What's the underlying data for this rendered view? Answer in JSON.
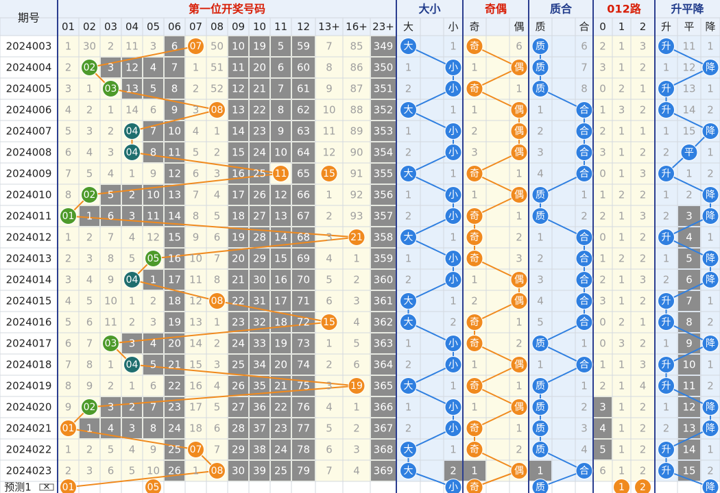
{
  "header": {
    "period_label": "期号",
    "groups": [
      {
        "title": "第一位开奖号码",
        "color": "#d81e06"
      },
      {
        "title": "大小",
        "color": "#1f3a8a"
      },
      {
        "title": "奇偶",
        "color": "#d81e06"
      },
      {
        "title": "质合",
        "color": "#1f3a8a"
      },
      {
        "title": "012路",
        "color": "#d81e06"
      },
      {
        "title": "升平降",
        "color": "#1f3a8a"
      }
    ],
    "subheaders": [
      "01",
      "02",
      "03",
      "04",
      "05",
      "06",
      "07",
      "08",
      "09",
      "10",
      "11",
      "12",
      "13+",
      "16+",
      "23+",
      "大",
      "",
      "小",
      "奇",
      "",
      "偶",
      "质",
      "",
      "合",
      "0",
      "1",
      "2",
      "升",
      "平",
      "降"
    ]
  },
  "chart_data": {
    "type": "table",
    "title": "第一位开奖号码",
    "rows": [
      {
        "period": "2024003",
        "cells": [
          "1",
          "30",
          "2",
          "11",
          "3",
          "6",
          "07",
          "50",
          "10",
          "19",
          "5",
          "59",
          "7",
          "85",
          "349",
          "大",
          "",
          "1",
          "奇",
          "",
          "6",
          "质",
          "",
          "6",
          "2",
          "1",
          "3",
          "升",
          "11",
          "1"
        ]
      },
      {
        "period": "2024004",
        "cells": [
          "2",
          "02",
          "3",
          "12",
          "4",
          "7",
          "1",
          "51",
          "11",
          "20",
          "6",
          "60",
          "8",
          "86",
          "350",
          "1",
          "",
          "小",
          "1",
          "",
          "偶",
          "质",
          "",
          "7",
          "3",
          "1",
          "2",
          "1",
          "12",
          "降"
        ]
      },
      {
        "period": "2024005",
        "cells": [
          "3",
          "1",
          "03",
          "13",
          "5",
          "8",
          "2",
          "52",
          "12",
          "21",
          "7",
          "61",
          "9",
          "87",
          "351",
          "2",
          "",
          "小",
          "奇",
          "",
          "1",
          "质",
          "",
          "8",
          "0",
          "2",
          "1",
          "升",
          "13",
          "1"
        ]
      },
      {
        "period": "2024006",
        "cells": [
          "4",
          "2",
          "1",
          "14",
          "6",
          "9",
          "3",
          "08",
          "13",
          "22",
          "8",
          "62",
          "10",
          "88",
          "352",
          "大",
          "",
          "1",
          "1",
          "",
          "偶",
          "1",
          "",
          "合",
          "1",
          "3",
          "2",
          "升",
          "14",
          "2"
        ]
      },
      {
        "period": "2024007",
        "cells": [
          "5",
          "3",
          "2",
          "04",
          "7",
          "10",
          "4",
          "1",
          "14",
          "23",
          "9",
          "63",
          "11",
          "89",
          "353",
          "1",
          "",
          "小",
          "2",
          "",
          "偶",
          "2",
          "",
          "合",
          "2",
          "1",
          "1",
          "1",
          "15",
          "降"
        ]
      },
      {
        "period": "2024008",
        "cells": [
          "6",
          "4",
          "3",
          "04",
          "8",
          "11",
          "5",
          "2",
          "15",
          "24",
          "10",
          "64",
          "12",
          "90",
          "354",
          "2",
          "",
          "小",
          "3",
          "",
          "偶",
          "3",
          "",
          "合",
          "3",
          "1",
          "2",
          "2",
          "平",
          "1"
        ]
      },
      {
        "period": "2024009",
        "cells": [
          "7",
          "5",
          "4",
          "1",
          "9",
          "12",
          "6",
          "3",
          "16",
          "25",
          "11",
          "65",
          "15",
          "91",
          "355",
          "大",
          "",
          "1",
          "奇",
          "",
          "1",
          "4",
          "",
          "合",
          "0",
          "1",
          "3",
          "升",
          "1",
          "2"
        ]
      },
      {
        "period": "2024010",
        "cells": [
          "8",
          "02",
          "5",
          "2",
          "10",
          "13",
          "7",
          "4",
          "17",
          "26",
          "12",
          "66",
          "1",
          "92",
          "356",
          "1",
          "",
          "小",
          "1",
          "",
          "偶",
          "质",
          "",
          "1",
          "1",
          "2",
          "2",
          "1",
          "2",
          "降"
        ]
      },
      {
        "period": "2024011",
        "cells": [
          "01",
          "1",
          "6",
          "3",
          "11",
          "14",
          "8",
          "5",
          "18",
          "27",
          "13",
          "67",
          "2",
          "93",
          "357",
          "2",
          "",
          "小",
          "奇",
          "",
          "1",
          "质",
          "",
          "2",
          "2",
          "1",
          "3",
          "2",
          "3",
          "降"
        ]
      },
      {
        "period": "2024012",
        "cells": [
          "1",
          "2",
          "7",
          "4",
          "12",
          "15",
          "9",
          "6",
          "19",
          "28",
          "14",
          "68",
          "3",
          "21",
          "358",
          "大",
          "",
          "1",
          "奇",
          "",
          "2",
          "1",
          "",
          "合",
          "0",
          "1",
          "2",
          "升",
          "4",
          "1"
        ]
      },
      {
        "period": "2024013",
        "cells": [
          "2",
          "3",
          "8",
          "5",
          "05",
          "16",
          "10",
          "7",
          "20",
          "29",
          "15",
          "69",
          "4",
          "1",
          "359",
          "1",
          "",
          "小",
          "奇",
          "",
          "3",
          "2",
          "",
          "合",
          "1",
          "2",
          "2",
          "1",
          "5",
          "降"
        ]
      },
      {
        "period": "2024014",
        "cells": [
          "3",
          "4",
          "9",
          "04",
          "1",
          "17",
          "11",
          "8",
          "21",
          "30",
          "16",
          "70",
          "5",
          "2",
          "360",
          "2",
          "",
          "小",
          "1",
          "",
          "偶",
          "3",
          "",
          "合",
          "2",
          "1",
          "3",
          "2",
          "6",
          "降"
        ]
      },
      {
        "period": "2024015",
        "cells": [
          "4",
          "5",
          "10",
          "1",
          "2",
          "18",
          "12",
          "08",
          "22",
          "31",
          "17",
          "71",
          "6",
          "3",
          "361",
          "大",
          "",
          "1",
          "2",
          "",
          "偶",
          "4",
          "",
          "合",
          "3",
          "1",
          "2",
          "升",
          "7",
          "1"
        ]
      },
      {
        "period": "2024016",
        "cells": [
          "5",
          "6",
          "11",
          "2",
          "3",
          "19",
          "13",
          "1",
          "23",
          "32",
          "18",
          "72",
          "15",
          "4",
          "362",
          "大",
          "",
          "2",
          "奇",
          "",
          "1",
          "5",
          "",
          "合",
          "0",
          "2",
          "1",
          "升",
          "8",
          "2"
        ]
      },
      {
        "period": "2024017",
        "cells": [
          "6",
          "7",
          "03",
          "3",
          "4",
          "20",
          "14",
          "2",
          "24",
          "33",
          "19",
          "73",
          "1",
          "5",
          "363",
          "1",
          "",
          "小",
          "奇",
          "",
          "2",
          "质",
          "",
          "1",
          "0",
          "3",
          "2",
          "1",
          "9",
          "降"
        ]
      },
      {
        "period": "2024018",
        "cells": [
          "7",
          "8",
          "1",
          "04",
          "5",
          "21",
          "15",
          "3",
          "25",
          "34",
          "20",
          "74",
          "2",
          "6",
          "364",
          "2",
          "",
          "小",
          "1",
          "",
          "偶",
          "1",
          "",
          "合",
          "1",
          "1",
          "3",
          "升",
          "10",
          "1"
        ]
      },
      {
        "period": "2024019",
        "cells": [
          "8",
          "9",
          "2",
          "1",
          "6",
          "22",
          "16",
          "4",
          "26",
          "35",
          "21",
          "75",
          "3",
          "19",
          "365",
          "大",
          "",
          "1",
          "奇",
          "",
          "1",
          "质",
          "",
          "1",
          "2",
          "1",
          "4",
          "升",
          "11",
          "2"
        ]
      },
      {
        "period": "2024020",
        "cells": [
          "9",
          "02",
          "3",
          "2",
          "7",
          "23",
          "17",
          "5",
          "27",
          "36",
          "22",
          "76",
          "4",
          "1",
          "366",
          "1",
          "",
          "小",
          "1",
          "",
          "偶",
          "质",
          "",
          "2",
          "3",
          "1",
          "2",
          "1",
          "12",
          "降"
        ]
      },
      {
        "period": "2024021",
        "cells": [
          "01",
          "1",
          "4",
          "3",
          "8",
          "24",
          "18",
          "6",
          "28",
          "37",
          "23",
          "77",
          "5",
          "2",
          "367",
          "2",
          "",
          "小",
          "奇",
          "",
          "1",
          "质",
          "",
          "3",
          "4",
          "1",
          "2",
          "2",
          "13",
          "降"
        ]
      },
      {
        "period": "2024022",
        "cells": [
          "1",
          "2",
          "5",
          "4",
          "9",
          "25",
          "07",
          "7",
          "29",
          "38",
          "24",
          "78",
          "6",
          "3",
          "368",
          "大",
          "",
          "1",
          "奇",
          "",
          "2",
          "质",
          "",
          "4",
          "5",
          "1",
          "2",
          "升",
          "14",
          "1"
        ]
      },
      {
        "period": "2024023",
        "cells": [
          "2",
          "3",
          "6",
          "5",
          "10",
          "26",
          "1",
          "08",
          "30",
          "39",
          "25",
          "79",
          "7",
          "4",
          "369",
          "大",
          "",
          "2",
          "1",
          "",
          "偶",
          "1",
          "",
          "合",
          "6",
          "1",
          "2",
          "升",
          "15",
          "2"
        ]
      },
      {
        "period": "预测1",
        "cells": [
          "01",
          "",
          "",
          "",
          "05",
          "",
          "",
          "",
          "",
          "",
          "",
          "",
          "",
          "",
          "",
          "",
          "",
          "小",
          "奇",
          "",
          "",
          "质",
          "",
          "",
          "",
          "1",
          "2",
          "",
          "",
          "降"
        ]
      }
    ],
    "x_marker": "✕"
  },
  "colors": {
    "header_bg": "#eaf1fa",
    "cream": "#fdfbe6",
    "blue_light": "#e6f0fb",
    "gray": "#8c8c8c",
    "red": "#d81e06",
    "blue": "#1f3a8a",
    "faint_text": "#a0a0a0",
    "ball_green": "#4d9a2a",
    "ball_teal": "#1f6e6e",
    "ball_orange": "#f08a1e",
    "ball_blue": "#2f7fe0",
    "line_orange": "#f08a1e",
    "line_blue": "#2f7fe0"
  }
}
